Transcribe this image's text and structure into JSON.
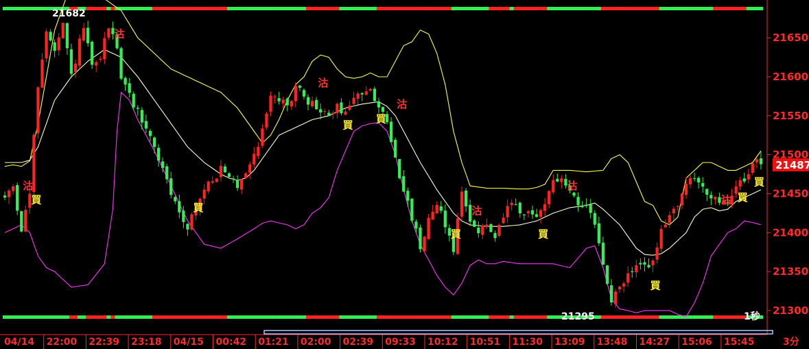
{
  "chart_data": {
    "type": "candlestick",
    "period_label": "3分",
    "y_ticks": [
      21300,
      21350,
      21400,
      21450,
      21500,
      21550,
      21600,
      21650
    ],
    "ylim": [
      21292,
      21688
    ],
    "x_ticks": [
      "04/14",
      "22:00",
      "22:39",
      "23:18",
      "04/15",
      "00:42",
      "01:21",
      "02:00",
      "02:39",
      "09:33",
      "10:12",
      "10:51",
      "11:30",
      "13:09",
      "13:48",
      "14:27",
      "15:06",
      "15:45"
    ],
    "last_price": 21487,
    "high_label": "21682",
    "low_label": "21295",
    "corner_label": "1秒",
    "bars_count": 183,
    "colors": {
      "background": "#000000",
      "up": "#ff2222",
      "down": "#33ee55",
      "upper_band": "#ffff40",
      "middle_band": "#ffffc8",
      "lower_band": "#ff33ff",
      "axis_text": "#ff2a2a",
      "buy_signal": "#ffee33",
      "sell_signal": "#ff3333"
    },
    "signals": [
      {
        "text": "沽",
        "bar": 5,
        "price": 21460,
        "kind": "sell"
      },
      {
        "text": "買",
        "bar": 7,
        "price": 21442,
        "kind": "buy"
      },
      {
        "text": "沽",
        "bar": 27,
        "price": 21655,
        "kind": "sell"
      },
      {
        "text": "買",
        "bar": 46,
        "price": 21432,
        "kind": "buy"
      },
      {
        "text": "沽",
        "bar": 76,
        "price": 21592,
        "kind": "sell"
      },
      {
        "text": "買",
        "bar": 82,
        "price": 21538,
        "kind": "buy"
      },
      {
        "text": "買",
        "bar": 90,
        "price": 21546,
        "kind": "buy"
      },
      {
        "text": "沽",
        "bar": 95,
        "price": 21565,
        "kind": "sell"
      },
      {
        "text": "買",
        "bar": 108,
        "price": 21398,
        "kind": "buy"
      },
      {
        "text": "沽",
        "bar": 113,
        "price": 21428,
        "kind": "sell"
      },
      {
        "text": "買",
        "bar": 129,
        "price": 21398,
        "kind": "buy"
      },
      {
        "text": "沽",
        "bar": 136,
        "price": 21460,
        "kind": "sell"
      },
      {
        "text": "買",
        "bar": 156,
        "price": 21332,
        "kind": "buy"
      },
      {
        "text": "沽",
        "bar": 173,
        "price": 21442,
        "kind": "sell"
      },
      {
        "text": "買",
        "bar": 177,
        "price": 21445,
        "kind": "buy"
      },
      {
        "text": "買",
        "bar": 181,
        "price": 21465,
        "kind": "buy"
      }
    ],
    "close_path": [
      [
        0,
        21445
      ],
      [
        2,
        21460
      ],
      [
        4,
        21405
      ],
      [
        6,
        21450
      ],
      [
        8,
        21590
      ],
      [
        10,
        21660
      ],
      [
        12,
        21630
      ],
      [
        14,
        21665
      ],
      [
        16,
        21600
      ],
      [
        19,
        21665
      ],
      [
        21,
        21610
      ],
      [
        23,
        21625
      ],
      [
        25,
        21665
      ],
      [
        27,
        21640
      ],
      [
        28,
        21600
      ],
      [
        30,
        21575
      ],
      [
        33,
        21545
      ],
      [
        36,
        21510
      ],
      [
        38,
        21480
      ],
      [
        40,
        21450
      ],
      [
        42,
        21425
      ],
      [
        44,
        21410
      ],
      [
        46,
        21430
      ],
      [
        48,
        21455
      ],
      [
        50,
        21470
      ],
      [
        52,
        21480
      ],
      [
        54,
        21470
      ],
      [
        56,
        21460
      ],
      [
        58,
        21480
      ],
      [
        60,
        21500
      ],
      [
        62,
        21530
      ],
      [
        64,
        21580
      ],
      [
        66,
        21570
      ],
      [
        68,
        21560
      ],
      [
        70,
        21590
      ],
      [
        72,
        21570
      ],
      [
        74,
        21565
      ],
      [
        76,
        21555
      ],
      [
        78,
        21550
      ],
      [
        80,
        21560
      ],
      [
        82,
        21555
      ],
      [
        84,
        21570
      ],
      [
        86,
        21580
      ],
      [
        88,
        21590
      ],
      [
        90,
        21560
      ],
      [
        92,
        21540
      ],
      [
        94,
        21500
      ],
      [
        96,
        21450
      ],
      [
        98,
        21420
      ],
      [
        100,
        21380
      ],
      [
        102,
        21420
      ],
      [
        104,
        21440
      ],
      [
        106,
        21410
      ],
      [
        108,
        21380
      ],
      [
        110,
        21450
      ],
      [
        112,
        21420
      ],
      [
        114,
        21400
      ],
      [
        116,
        21410
      ],
      [
        118,
        21390
      ],
      [
        120,
        21420
      ],
      [
        122,
        21440
      ],
      [
        124,
        21420
      ],
      [
        126,
        21425
      ],
      [
        128,
        21420
      ],
      [
        130,
        21440
      ],
      [
        132,
        21470
      ],
      [
        134,
        21465
      ],
      [
        136,
        21455
      ],
      [
        138,
        21440
      ],
      [
        140,
        21430
      ],
      [
        142,
        21410
      ],
      [
        144,
        21360
      ],
      [
        146,
        21310
      ],
      [
        148,
        21330
      ],
      [
        150,
        21345
      ],
      [
        152,
        21355
      ],
      [
        154,
        21360
      ],
      [
        156,
        21360
      ],
      [
        158,
        21400
      ],
      [
        160,
        21420
      ],
      [
        162,
        21440
      ],
      [
        164,
        21460
      ],
      [
        166,
        21470
      ],
      [
        168,
        21460
      ],
      [
        170,
        21445
      ],
      [
        172,
        21435
      ],
      [
        174,
        21440
      ],
      [
        176,
        21460
      ],
      [
        178,
        21470
      ],
      [
        180,
        21490
      ],
      [
        182,
        21487
      ]
    ],
    "upper_band_path": [
      [
        0,
        21485
      ],
      [
        2,
        21487
      ],
      [
        4,
        21485
      ],
      [
        6,
        21492
      ],
      [
        8,
        21540
      ],
      [
        10,
        21600
      ],
      [
        12,
        21660
      ],
      [
        16,
        21720
      ],
      [
        20,
        21720
      ],
      [
        24,
        21700
      ],
      [
        28,
        21685
      ],
      [
        32,
        21650
      ],
      [
        36,
        21630
      ],
      [
        40,
        21610
      ],
      [
        44,
        21600
      ],
      [
        48,
        21590
      ],
      [
        52,
        21580
      ],
      [
        56,
        21560
      ],
      [
        60,
        21530
      ],
      [
        62,
        21515
      ],
      [
        64,
        21525
      ],
      [
        66,
        21545
      ],
      [
        68,
        21570
      ],
      [
        70,
        21590
      ],
      [
        72,
        21600
      ],
      [
        74,
        21620
      ],
      [
        76,
        21628
      ],
      [
        78,
        21625
      ],
      [
        80,
        21610
      ],
      [
        82,
        21600
      ],
      [
        84,
        21598
      ],
      [
        86,
        21600
      ],
      [
        88,
        21605
      ],
      [
        90,
        21600
      ],
      [
        92,
        21600
      ],
      [
        94,
        21620
      ],
      [
        96,
        21640
      ],
      [
        98,
        21645
      ],
      [
        100,
        21660
      ],
      [
        102,
        21655
      ],
      [
        104,
        21630
      ],
      [
        106,
        21590
      ],
      [
        108,
        21530
      ],
      [
        110,
        21490
      ],
      [
        112,
        21460
      ],
      [
        116,
        21457
      ],
      [
        120,
        21457
      ],
      [
        124,
        21456
      ],
      [
        126,
        21456
      ],
      [
        128,
        21458
      ],
      [
        130,
        21462
      ],
      [
        132,
        21480
      ],
      [
        134,
        21480
      ],
      [
        136,
        21480
      ],
      [
        140,
        21478
      ],
      [
        144,
        21480
      ],
      [
        146,
        21495
      ],
      [
        148,
        21500
      ],
      [
        150,
        21490
      ],
      [
        152,
        21465
      ],
      [
        154,
        21440
      ],
      [
        156,
        21435
      ],
      [
        158,
        21415
      ],
      [
        160,
        21410
      ],
      [
        162,
        21420
      ],
      [
        164,
        21470
      ],
      [
        166,
        21480
      ],
      [
        168,
        21490
      ],
      [
        170,
        21490
      ],
      [
        172,
        21485
      ],
      [
        174,
        21480
      ],
      [
        176,
        21480
      ],
      [
        178,
        21485
      ],
      [
        180,
        21490
      ],
      [
        182,
        21505
      ]
    ],
    "middle_band_path": [
      [
        0,
        21490
      ],
      [
        2,
        21490
      ],
      [
        4,
        21490
      ],
      [
        6,
        21493
      ],
      [
        8,
        21510
      ],
      [
        10,
        21540
      ],
      [
        12,
        21570
      ],
      [
        16,
        21600
      ],
      [
        20,
        21620
      ],
      [
        24,
        21635
      ],
      [
        26,
        21630
      ],
      [
        28,
        21625
      ],
      [
        32,
        21600
      ],
      [
        36,
        21570
      ],
      [
        40,
        21540
      ],
      [
        44,
        21510
      ],
      [
        48,
        21490
      ],
      [
        52,
        21475
      ],
      [
        54,
        21470
      ],
      [
        56,
        21467
      ],
      [
        58,
        21470
      ],
      [
        60,
        21480
      ],
      [
        62,
        21495
      ],
      [
        64,
        21510
      ],
      [
        66,
        21525
      ],
      [
        70,
        21535
      ],
      [
        74,
        21545
      ],
      [
        78,
        21550
      ],
      [
        82,
        21560
      ],
      [
        86,
        21565
      ],
      [
        90,
        21568
      ],
      [
        92,
        21562
      ],
      [
        94,
        21550
      ],
      [
        96,
        21530
      ],
      [
        98,
        21510
      ],
      [
        100,
        21490
      ],
      [
        104,
        21455
      ],
      [
        108,
        21425
      ],
      [
        110,
        21415
      ],
      [
        112,
        21410
      ],
      [
        116,
        21408
      ],
      [
        120,
        21408
      ],
      [
        124,
        21410
      ],
      [
        128,
        21415
      ],
      [
        132,
        21425
      ],
      [
        136,
        21432
      ],
      [
        140,
        21435
      ],
      [
        142,
        21438
      ],
      [
        144,
        21430
      ],
      [
        146,
        21420
      ],
      [
        148,
        21410
      ],
      [
        150,
        21395
      ],
      [
        152,
        21380
      ],
      [
        154,
        21372
      ],
      [
        156,
        21371
      ],
      [
        158,
        21373
      ],
      [
        160,
        21380
      ],
      [
        162,
        21390
      ],
      [
        164,
        21400
      ],
      [
        166,
        21420
      ],
      [
        168,
        21430
      ],
      [
        170,
        21432
      ],
      [
        172,
        21428
      ],
      [
        174,
        21430
      ],
      [
        176,
        21440
      ],
      [
        178,
        21445
      ],
      [
        180,
        21450
      ],
      [
        182,
        21455
      ]
    ],
    "lower_band_path": [
      [
        0,
        21400
      ],
      [
        2,
        21405
      ],
      [
        4,
        21410
      ],
      [
        6,
        21400
      ],
      [
        8,
        21370
      ],
      [
        10,
        21355
      ],
      [
        12,
        21350
      ],
      [
        14,
        21340
      ],
      [
        16,
        21330
      ],
      [
        20,
        21333
      ],
      [
        24,
        21360
      ],
      [
        26,
        21430
      ],
      [
        27,
        21530
      ],
      [
        28,
        21580
      ],
      [
        30,
        21570
      ],
      [
        32,
        21545
      ],
      [
        36,
        21505
      ],
      [
        40,
        21460
      ],
      [
        44,
        21415
      ],
      [
        48,
        21385
      ],
      [
        52,
        21380
      ],
      [
        56,
        21392
      ],
      [
        60,
        21405
      ],
      [
        62,
        21412
      ],
      [
        64,
        21415
      ],
      [
        68,
        21410
      ],
      [
        70,
        21405
      ],
      [
        72,
        21410
      ],
      [
        74,
        21425
      ],
      [
        76,
        21432
      ],
      [
        78,
        21445
      ],
      [
        80,
        21480
      ],
      [
        82,
        21505
      ],
      [
        84,
        21530
      ],
      [
        86,
        21537
      ],
      [
        88,
        21540
      ],
      [
        90,
        21541
      ],
      [
        92,
        21530
      ],
      [
        94,
        21500
      ],
      [
        96,
        21455
      ],
      [
        98,
        21415
      ],
      [
        100,
        21385
      ],
      [
        102,
        21365
      ],
      [
        104,
        21345
      ],
      [
        106,
        21330
      ],
      [
        108,
        21320
      ],
      [
        110,
        21335
      ],
      [
        112,
        21358
      ],
      [
        114,
        21365
      ],
      [
        116,
        21360
      ],
      [
        118,
        21360
      ],
      [
        120,
        21363
      ],
      [
        124,
        21360
      ],
      [
        128,
        21360
      ],
      [
        132,
        21360
      ],
      [
        136,
        21355
      ],
      [
        140,
        21380
      ],
      [
        142,
        21383
      ],
      [
        144,
        21355
      ],
      [
        146,
        21315
      ],
      [
        148,
        21302
      ],
      [
        150,
        21300
      ],
      [
        152,
        21297
      ],
      [
        154,
        21300
      ],
      [
        156,
        21300
      ],
      [
        160,
        21300
      ],
      [
        162,
        21295
      ],
      [
        164,
        21292
      ],
      [
        166,
        21310
      ],
      [
        168,
        21335
      ],
      [
        170,
        21370
      ],
      [
        172,
        21385
      ],
      [
        174,
        21400
      ],
      [
        176,
        21405
      ],
      [
        178,
        21415
      ],
      [
        180,
        21413
      ],
      [
        182,
        21410
      ]
    ]
  }
}
